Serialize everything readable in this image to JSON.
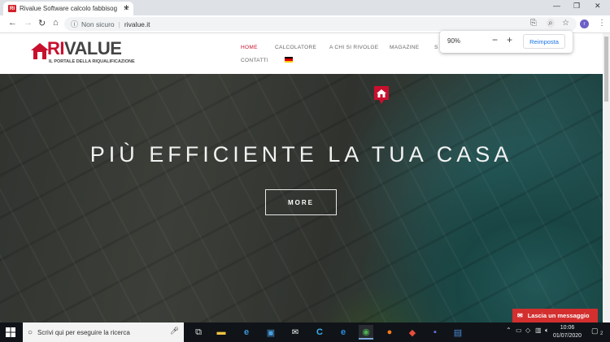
{
  "browser": {
    "tab_title": "Rivalue Software calcolo fabbisog",
    "favicon_text": "RI",
    "url_security": "Non sicuro",
    "url": "rivalue.it",
    "profile_initial": "r"
  },
  "zoom_popup": {
    "value": "90%",
    "reset_label": "Reimposta"
  },
  "site": {
    "logo_ri": "RI",
    "logo_value": "VALUE",
    "logo_sub": "IL PORTALE DELLA RIQUALIFICAZIONE",
    "nav": [
      {
        "label": "HOME",
        "active": true
      },
      {
        "label": "CALCOLATORE",
        "active": false
      },
      {
        "label": "A CHI SI RIVOLGE",
        "active": false
      },
      {
        "label": "MAGAZINE",
        "active": false
      },
      {
        "label": "S",
        "active": false
      },
      {
        "label": "CONTATTI",
        "active": false
      }
    ],
    "hero_title": "PIÙ EFFICIENTE LA TUA CASA",
    "more_label": "MORE",
    "chat_label": "Lascia un messaggio"
  },
  "taskbar": {
    "search_placeholder": "Scrivi qui per eseguire la ricerca",
    "time": "10:06",
    "date": "01/07/2020",
    "notification_count": "2"
  },
  "colors": {
    "brand_red": "#c8102e",
    "chat_red": "#d32f2f",
    "taskbar": "#101418"
  }
}
